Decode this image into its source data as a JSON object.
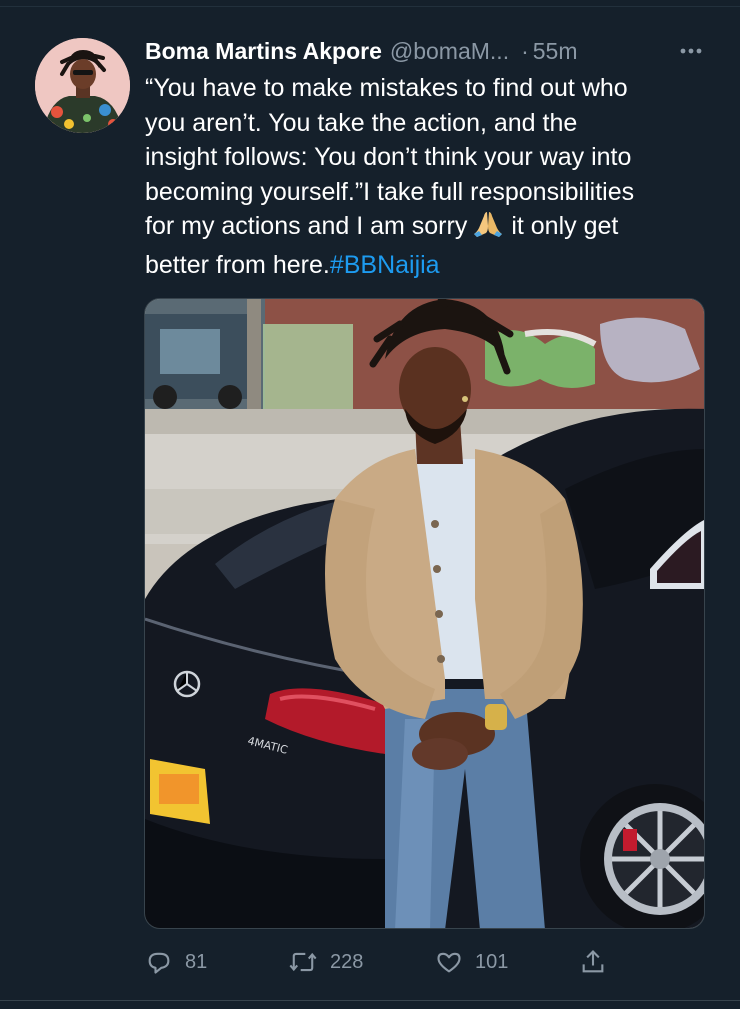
{
  "tweet": {
    "display_name": "Boma Martins Akpore",
    "handle": "@bomaM...",
    "separator": "·",
    "time": "55m",
    "text_lines": [
      "“You have to make mistakes to find out who",
      "you aren’t. You take the action, and the",
      "insight follows: You don’t think your way into",
      "becoming yourself.”I take full responsibilities"
    ],
    "line5_before": "for my actions and I am sorry",
    "line5_emoji_icon": "folded-hands-icon",
    "line5_after": "it only get",
    "line6_text": "better from here.",
    "hashtag": "#BBNaijia",
    "more_icon": "more-options-icon",
    "media_description_icon": "photo-man-leaning-on-car"
  },
  "actions": {
    "reply": {
      "icon": "reply-icon",
      "count": "81"
    },
    "retweet": {
      "icon": "retweet-icon",
      "count": "228"
    },
    "like": {
      "icon": "heart-icon",
      "count": "101"
    },
    "share": {
      "icon": "share-icon"
    }
  },
  "colors": {
    "background": "#15202b",
    "text_primary": "#ffffff",
    "text_secondary": "#8b98a5",
    "link": "#1d9bf0"
  }
}
